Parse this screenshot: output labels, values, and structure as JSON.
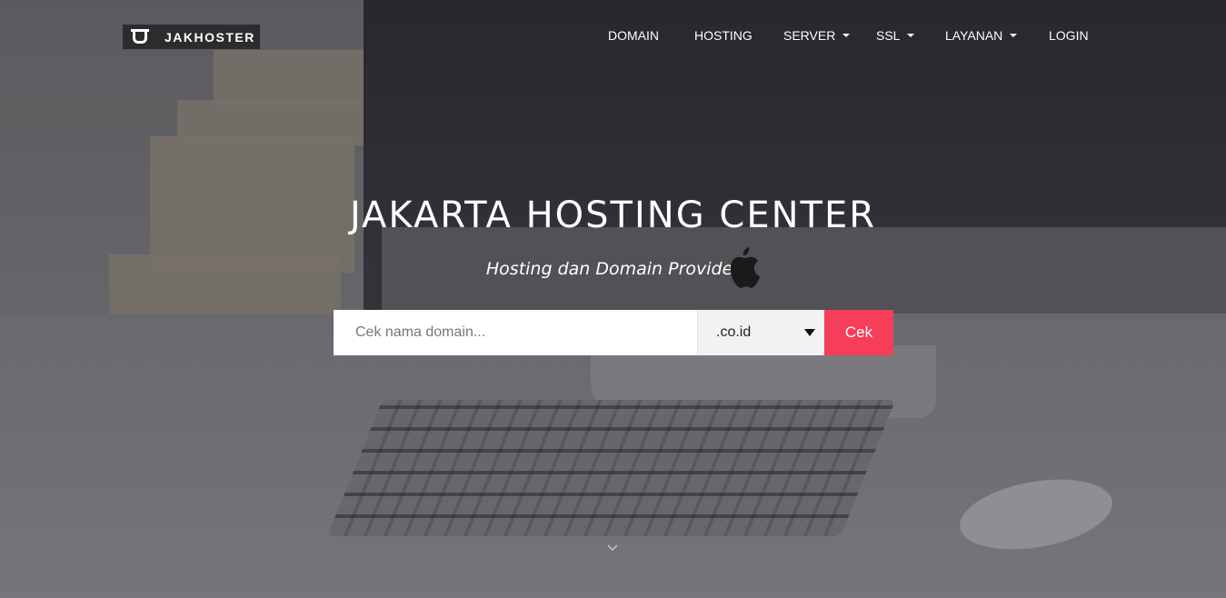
{
  "brand": {
    "name": "JAKHOSTER"
  },
  "nav": {
    "items": [
      {
        "label": "DOMAIN",
        "dropdown": false
      },
      {
        "label": "HOSTING",
        "dropdown": false
      },
      {
        "label": "SERVER",
        "dropdown": true
      },
      {
        "label": "SSL",
        "dropdown": true
      },
      {
        "label": "LAYANAN",
        "dropdown": true
      },
      {
        "label": "LOGIN",
        "dropdown": false
      }
    ]
  },
  "hero": {
    "title": "JAKARTA HOSTING CENTER",
    "subtitle": "Hosting dan Domain Provider",
    "subtitle_icon": "apple-icon"
  },
  "search": {
    "placeholder": "Cek nama domain...",
    "value": "",
    "tld_selected": ".co.id",
    "button_label": "Cek"
  },
  "scroll_icon": "chevron-down-icon",
  "colors": {
    "accent": "#f63d5a",
    "logo_bg": "#2c2c2e",
    "text": "#ffffff"
  }
}
